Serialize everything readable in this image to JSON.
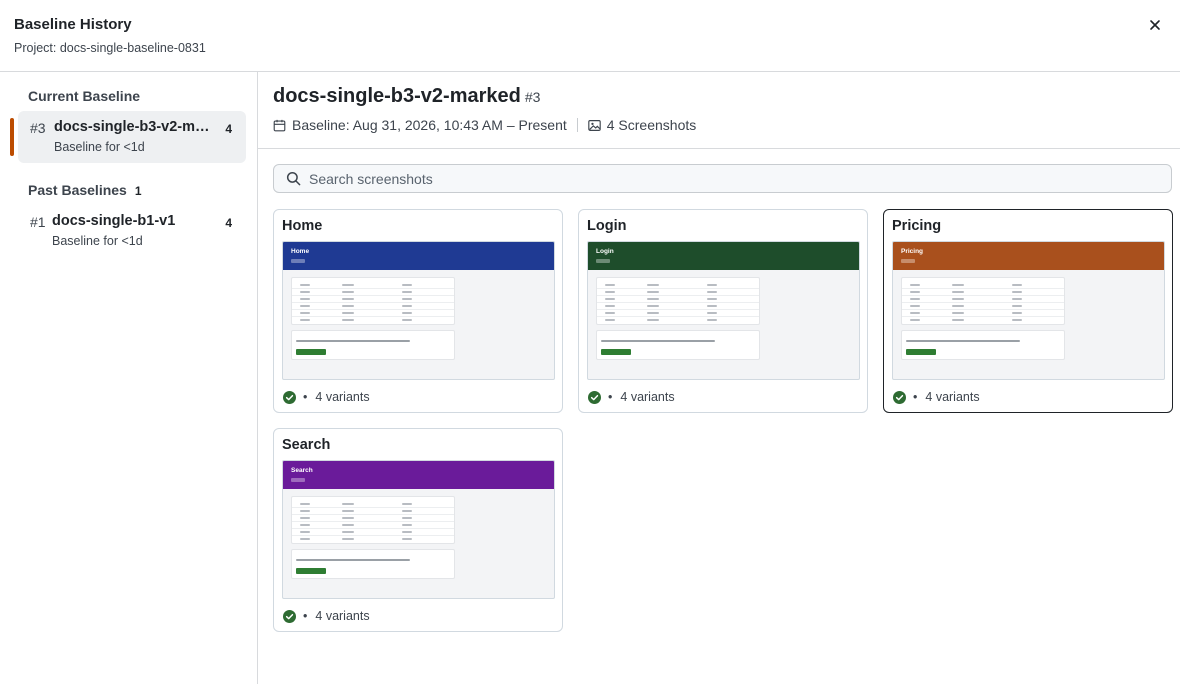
{
  "dialog": {
    "title": "Baseline History",
    "project": "Project: docs-single-baseline-0831"
  },
  "sidebar": {
    "current_title": "Current Baseline",
    "current": {
      "num": "#3",
      "name": "docs-single-b3-v2-ma…",
      "count": "4",
      "sub": "Baseline for <1d"
    },
    "past_title": "Past Baselines",
    "past_count": "1",
    "past": [
      {
        "num": "#1",
        "name": "docs-single-b1-v1",
        "count": "4",
        "sub": "Baseline for <1d"
      }
    ]
  },
  "main": {
    "title": "docs-single-b3-v2-marked",
    "title_num": "#3",
    "baseline_range": "Baseline: Aug 31, 2026, 10:43 AM – Present",
    "screenshots": "4 Screenshots",
    "search_placeholder": "Search screenshots"
  },
  "cards": [
    {
      "title": "Home",
      "thumb_title": "Home",
      "color": "#1f3a93",
      "variants": "4 variants",
      "selected": false
    },
    {
      "title": "Login",
      "thumb_title": "Login",
      "color": "#1e4d2b",
      "variants": "4 variants",
      "selected": false
    },
    {
      "title": "Pricing",
      "thumb_title": "Pricing",
      "color": "#a9501d",
      "variants": "4 variants",
      "selected": true
    },
    {
      "title": "Search",
      "thumb_title": "Search",
      "color": "#6a1b9a",
      "variants": "4 variants",
      "selected": false
    }
  ],
  "colors": {
    "accent": "#bc4c00",
    "success": "#2e6b32"
  }
}
